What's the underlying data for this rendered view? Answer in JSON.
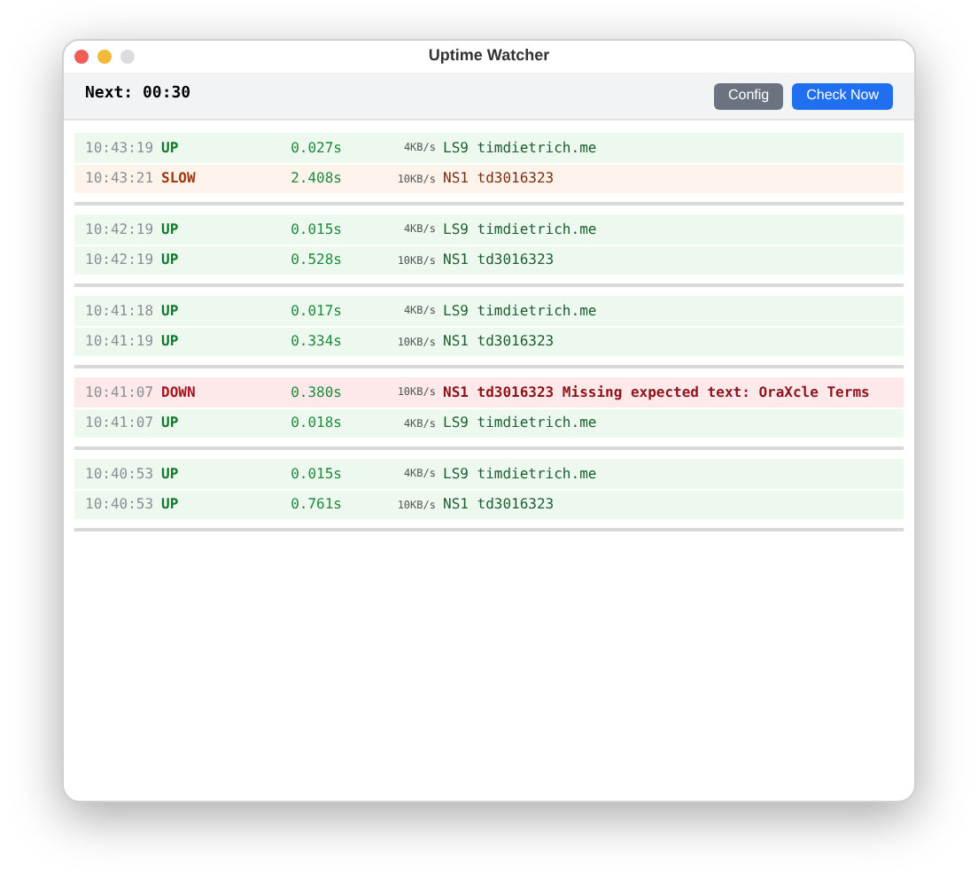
{
  "window": {
    "title": "Uptime Watcher"
  },
  "toolbar": {
    "countdown": "Next: 00:30",
    "buttons": [
      {
        "label": "Config",
        "kind": "secondary"
      },
      {
        "label": "Check Now",
        "kind": "primary"
      }
    ]
  },
  "groups": [
    {
      "rows": [
        {
          "time": "10:43:19",
          "status": "UP",
          "kind": "up",
          "latency": "0.027s",
          "rate": "4KB/s",
          "target": "LS9 timdietrich.me"
        },
        {
          "time": "10:43:21",
          "status": "SLOW",
          "kind": "slow",
          "latency": "2.408s",
          "rate": "10KB/s",
          "target": "NS1 td3016323"
        }
      ]
    },
    {
      "rows": [
        {
          "time": "10:42:19",
          "status": "UP",
          "kind": "up",
          "latency": "0.015s",
          "rate": "4KB/s",
          "target": "LS9 timdietrich.me"
        },
        {
          "time": "10:42:19",
          "status": "UP",
          "kind": "up",
          "latency": "0.528s",
          "rate": "10KB/s",
          "target": "NS1 td3016323"
        }
      ]
    },
    {
      "rows": [
        {
          "time": "10:41:18",
          "status": "UP",
          "kind": "up",
          "latency": "0.017s",
          "rate": "4KB/s",
          "target": "LS9 timdietrich.me"
        },
        {
          "time": "10:41:19",
          "status": "UP",
          "kind": "up",
          "latency": "0.334s",
          "rate": "10KB/s",
          "target": "NS1 td3016323"
        }
      ]
    },
    {
      "rows": [
        {
          "time": "10:41:07",
          "status": "DOWN",
          "kind": "down",
          "latency": "0.380s",
          "rate": "10KB/s",
          "target": "NS1 td3016323 Missing expected text: OraXcle Terms"
        },
        {
          "time": "10:41:07",
          "status": "UP",
          "kind": "up",
          "latency": "0.018s",
          "rate": "4KB/s",
          "target": "LS9 timdietrich.me"
        }
      ]
    },
    {
      "rows": [
        {
          "time": "10:40:53",
          "status": "UP",
          "kind": "up",
          "latency": "0.015s",
          "rate": "4KB/s",
          "target": "LS9 timdietrich.me"
        },
        {
          "time": "10:40:53",
          "status": "UP",
          "kind": "up",
          "latency": "0.761s",
          "rate": "10KB/s",
          "target": "NS1 td3016323"
        }
      ]
    }
  ]
}
